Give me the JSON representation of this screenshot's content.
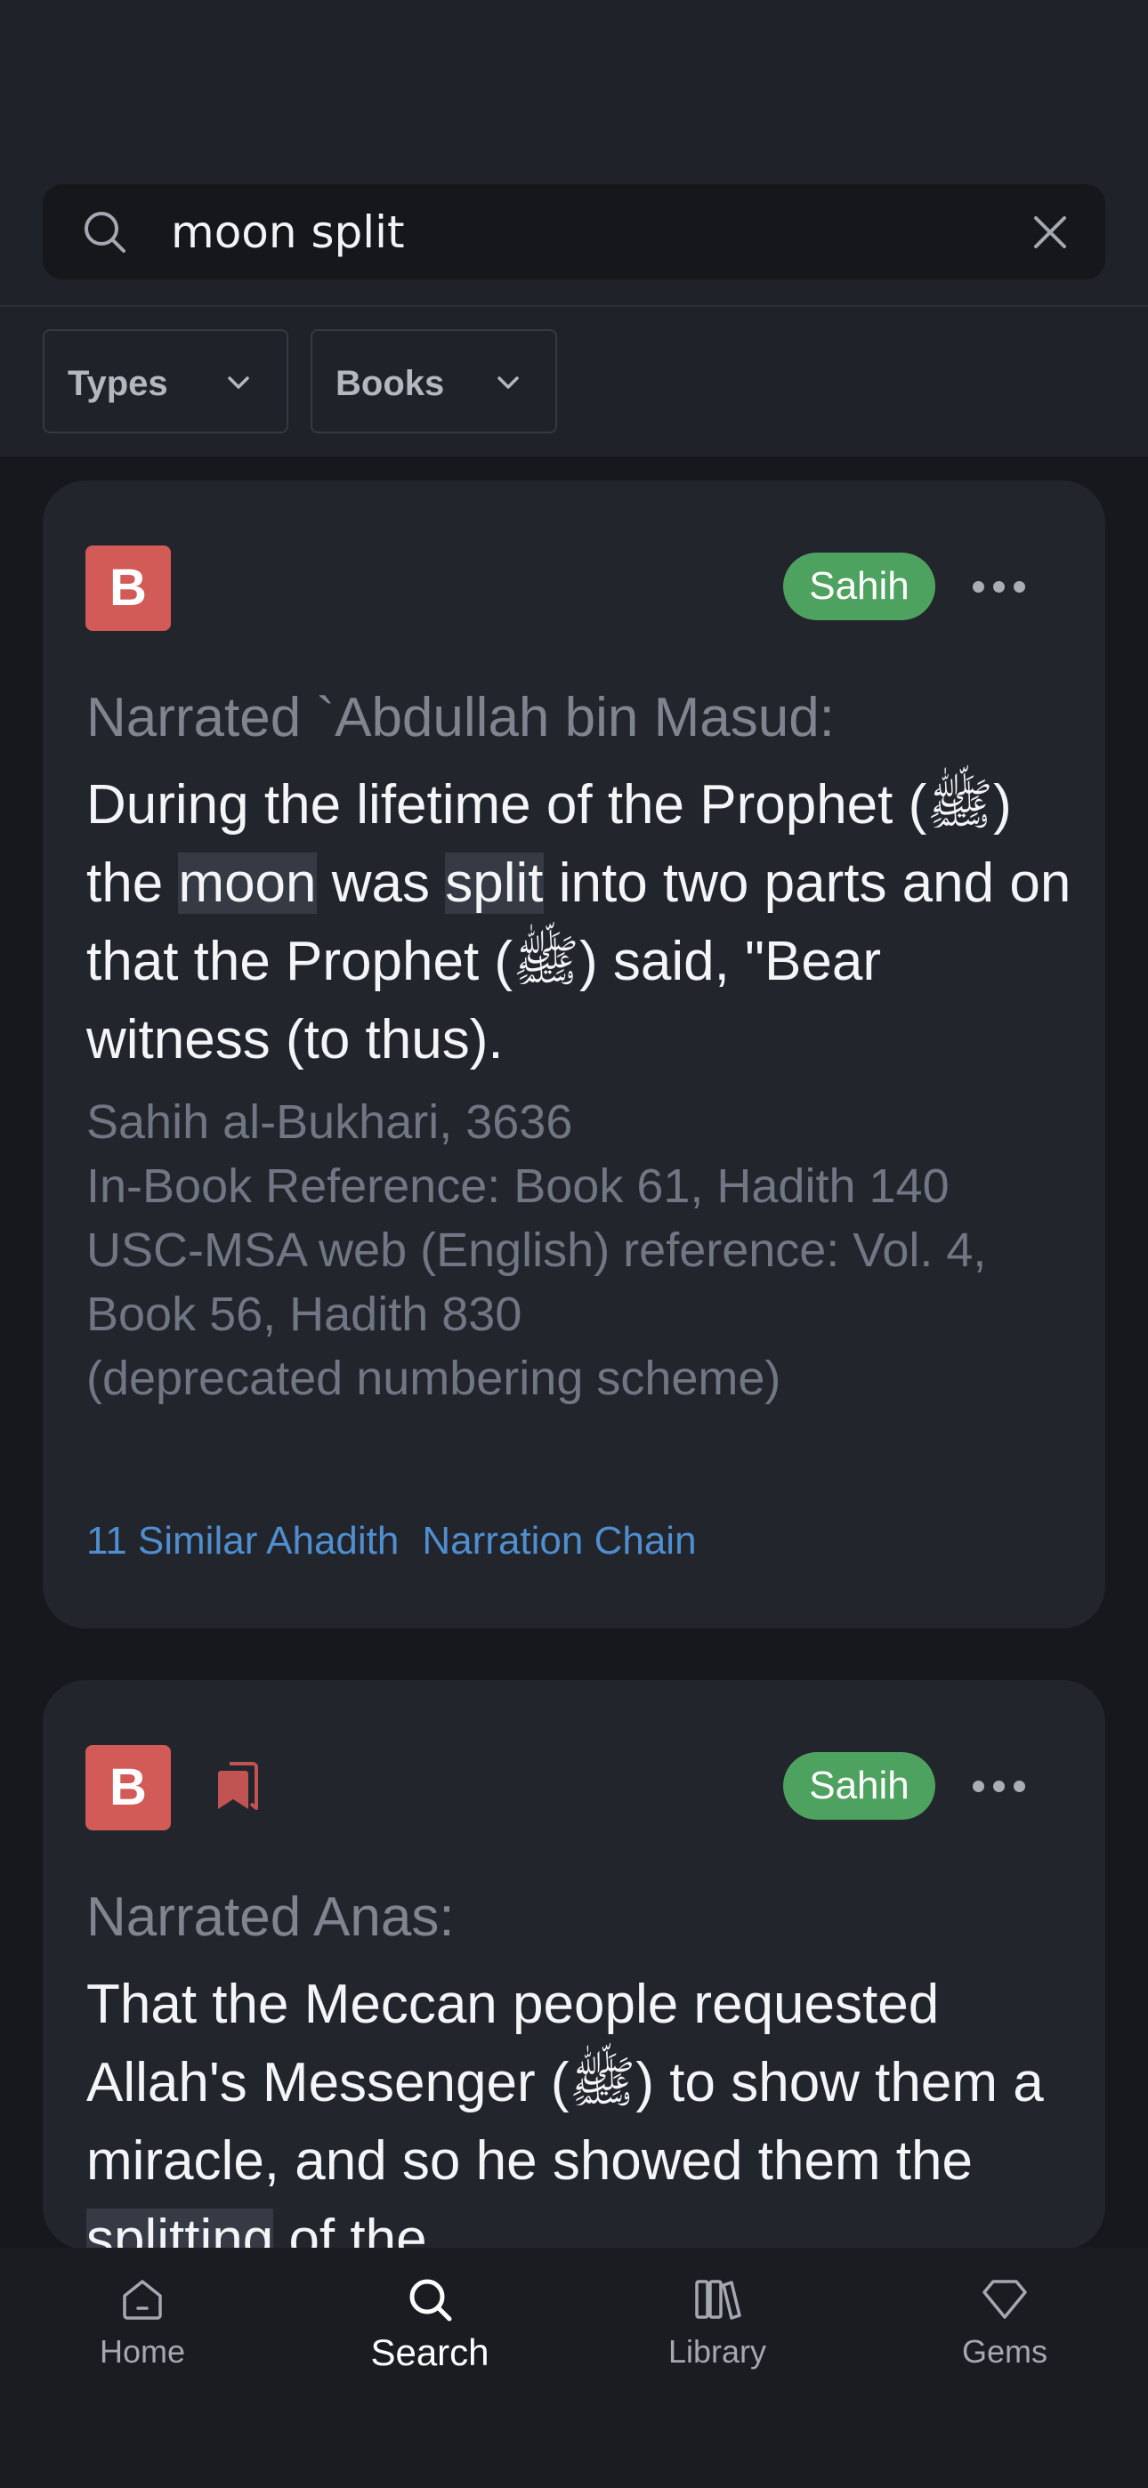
{
  "search": {
    "query": "moon split"
  },
  "filters": {
    "types_label": "Types",
    "books_label": "Books"
  },
  "results": [
    {
      "book_badge": "B",
      "grade": "Sahih",
      "narrator": "Narrated `Abdullah bin Masud:",
      "body_parts": [
        "During the lifetime of the Prophet (ﷺ) the ",
        "moon",
        " was ",
        "split",
        " into two parts and on that the Prophet (ﷺ) said, \"Bear witness (to thus)."
      ],
      "reference_lines": [
        "Sahih al-Bukhari, 3636",
        "In-Book Reference: Book 61, Hadith 140",
        "USC-MSA web (English) reference: Vol. 4, Book 56, Hadith 830",
        "(deprecated numbering scheme)"
      ],
      "similar_link": "11 Similar Ahadith",
      "chain_link": "Narration Chain"
    },
    {
      "book_badge": "B",
      "grade": "Sahih",
      "narrator": "Narrated Anas:",
      "body_parts": [
        "That the Meccan people requested Allah's Messenger (ﷺ) to show them a miracle, and so he showed them the ",
        "splitting",
        " of the"
      ]
    }
  ],
  "nav": [
    {
      "label": "Home",
      "icon": "home-icon"
    },
    {
      "label": "Search",
      "icon": "search-icon",
      "active": true
    },
    {
      "label": "Library",
      "icon": "library-icon"
    },
    {
      "label": "Gems",
      "icon": "gem-icon"
    }
  ],
  "colors": {
    "accent": "#4ea260",
    "badge": "#d25a57",
    "link": "#4f8ecf"
  }
}
